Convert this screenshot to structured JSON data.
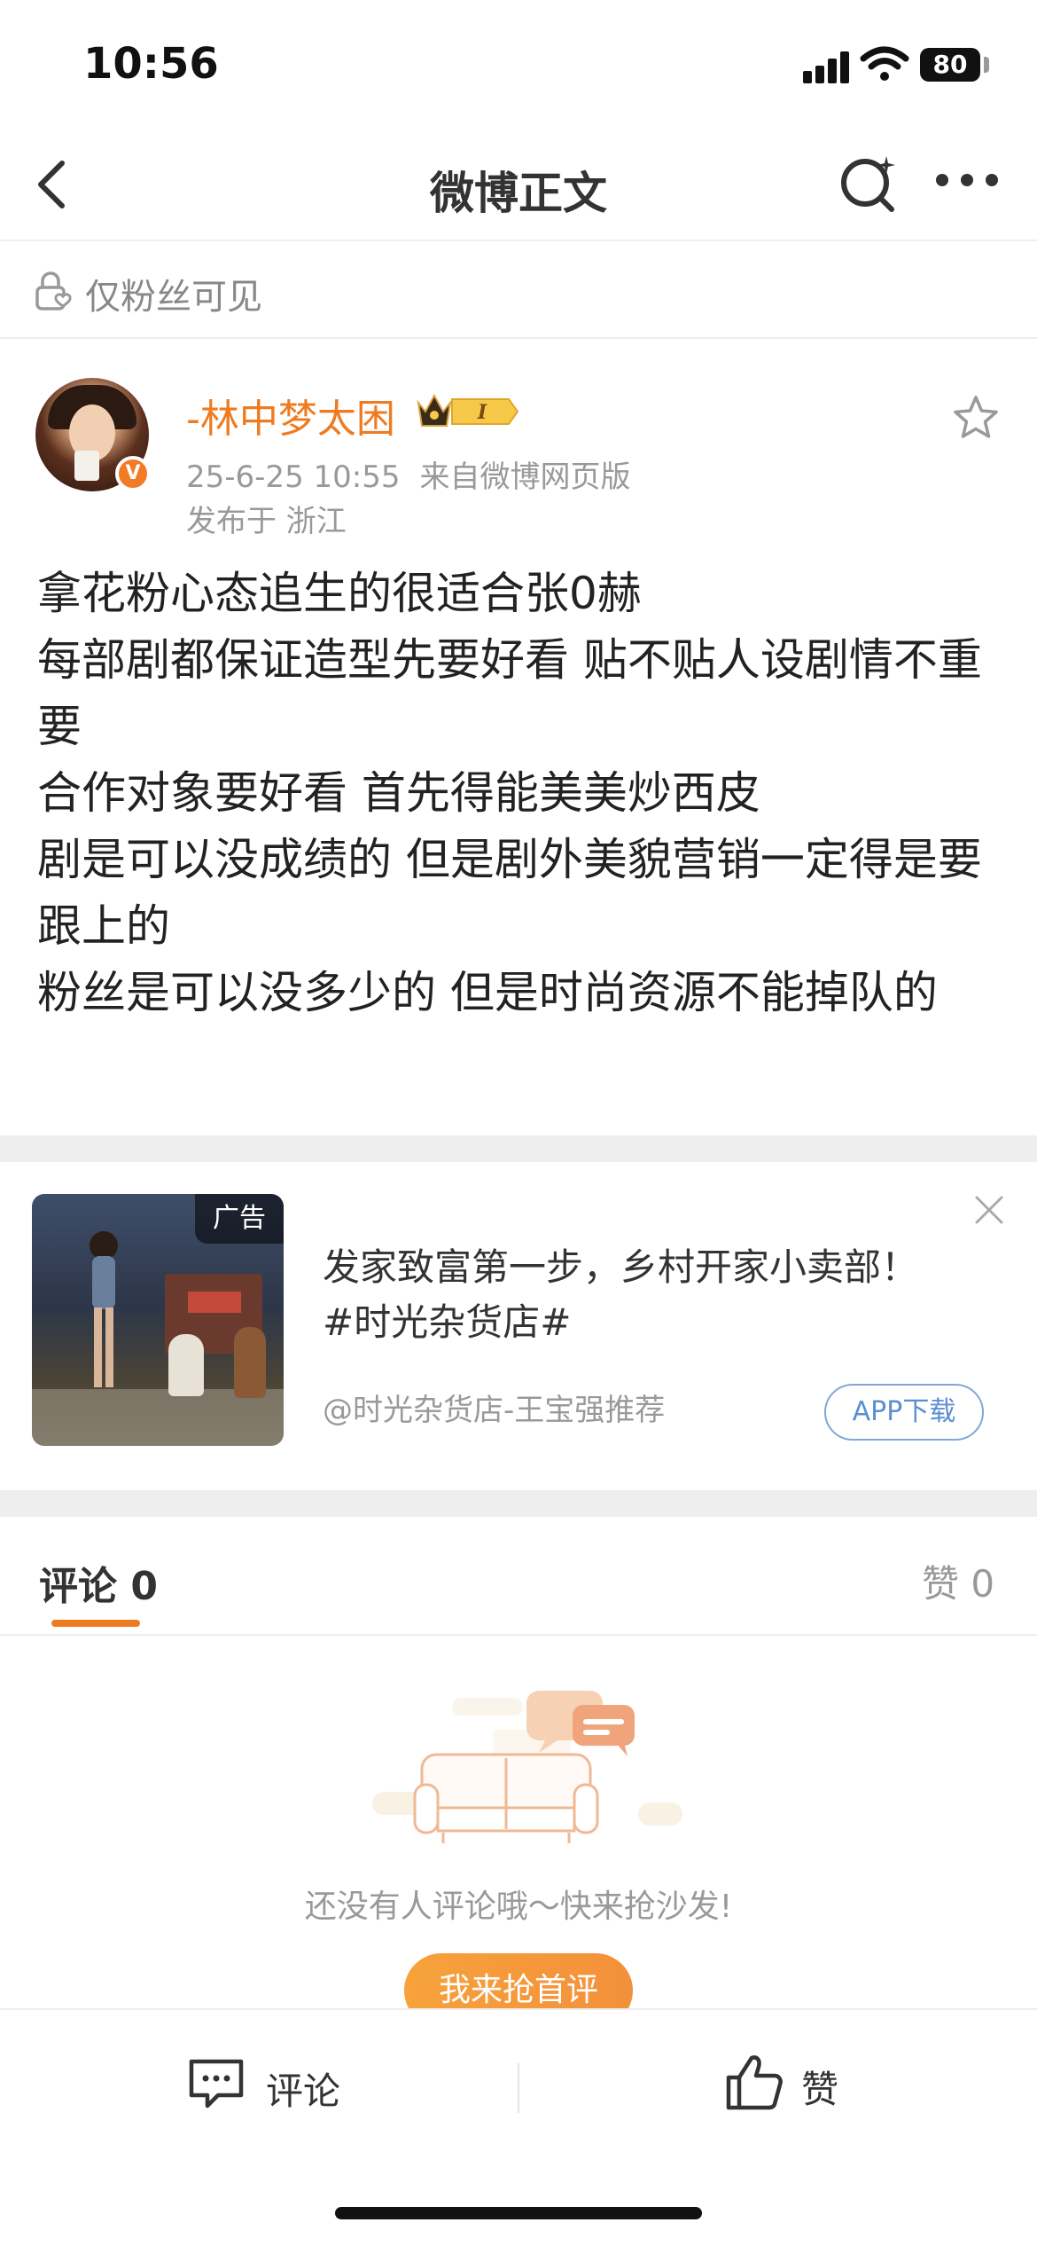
{
  "status_bar": {
    "time": "10:56",
    "battery": "80"
  },
  "nav": {
    "title": "微博正文"
  },
  "visibility": {
    "label": "仅粉丝可见"
  },
  "post": {
    "author": "-林中梦太困",
    "verified_badge": "V",
    "member_badge": "I",
    "timestamp": "25-6-25 10:55",
    "source": "来自微博网页版",
    "location": "发布于 浙江",
    "lines": [
      "拿花粉心态追生的很适合张0赫",
      "每部剧都保证造型先要好看 贴不贴人设剧情不重要",
      "合作对象要好看 首先得能美美炒西皮",
      "剧是可以没成绩的 但是剧外美貌营销一定得是要跟上的",
      "粉丝是可以没多少的 但是时尚资源不能掉队的"
    ]
  },
  "ad": {
    "tag": "广告",
    "title_line1": "发家致富第一步，乡村开家小卖部！",
    "title_line2": "#时光杂货店#",
    "source": "@时光杂货店-王宝强推荐",
    "download_label": "APP下载"
  },
  "comments": {
    "tab_label": "评论 0",
    "like_label": "赞 0",
    "empty_text": "还没有人评论哦～快来抢沙发!",
    "first_comment_label": "我来抢首评"
  },
  "bottom_bar": {
    "comment_label": "评论",
    "like_label": "赞"
  },
  "colors": {
    "accent": "#ef7b21",
    "link_blue": "#5b8fd1",
    "muted": "#999999"
  }
}
